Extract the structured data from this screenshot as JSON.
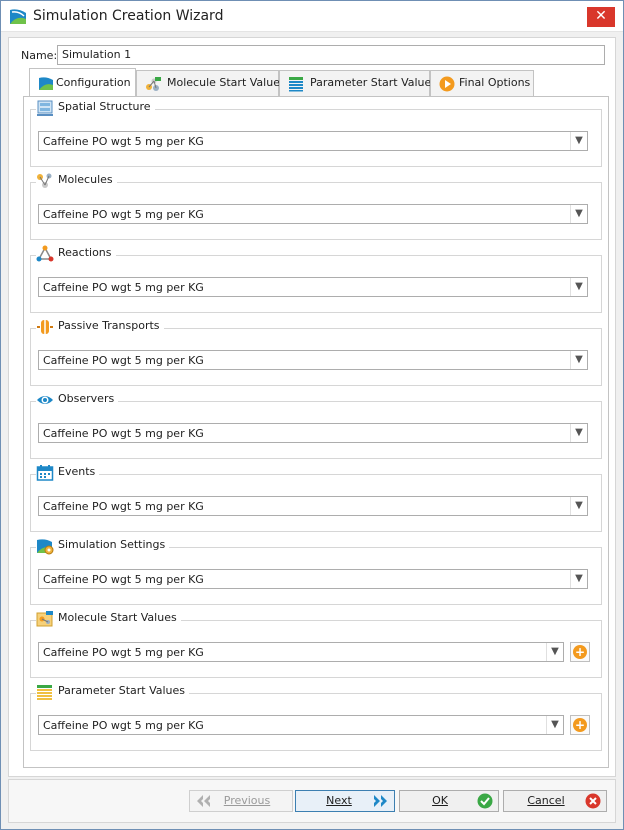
{
  "window": {
    "title": "Simulation Creation Wizard",
    "close_symbol": "✕"
  },
  "name_field": {
    "label": "Name:",
    "value": "Simulation 1"
  },
  "tabs": [
    {
      "label": "Configuration",
      "icon": "configuration-icon",
      "active": true
    },
    {
      "label": "Molecule Start Values",
      "icon": "molecule-start-values-icon",
      "active": false
    },
    {
      "label": "Parameter Start Values",
      "icon": "parameter-start-values-icon",
      "active": false
    },
    {
      "label": "Final Options",
      "icon": "final-options-icon",
      "active": false
    }
  ],
  "groups": [
    {
      "label": "Spatial Structure",
      "icon": "spatial-structure-icon",
      "value": "Caffeine PO wgt 5 mg per KG",
      "has_add": false
    },
    {
      "label": "Molecules",
      "icon": "molecules-icon",
      "value": "Caffeine PO wgt 5 mg per KG",
      "has_add": false
    },
    {
      "label": "Reactions",
      "icon": "reactions-icon",
      "value": "Caffeine PO wgt 5 mg per KG",
      "has_add": false
    },
    {
      "label": "Passive Transports",
      "icon": "passive-transports-icon",
      "value": "Caffeine PO wgt 5 mg per KG",
      "has_add": false
    },
    {
      "label": "Observers",
      "icon": "observers-icon",
      "value": "Caffeine PO wgt 5 mg per KG",
      "has_add": false
    },
    {
      "label": "Events",
      "icon": "events-icon",
      "value": "Caffeine PO wgt 5 mg per KG",
      "has_add": false
    },
    {
      "label": "Simulation Settings",
      "icon": "simulation-settings-icon",
      "value": "Caffeine PO wgt 5 mg per KG",
      "has_add": false
    },
    {
      "label": "Molecule Start Values",
      "icon": "molecule-start-values-icon",
      "value": "Caffeine PO wgt 5 mg per KG",
      "has_add": true
    },
    {
      "label": "Parameter Start Values",
      "icon": "parameter-start-values-icon",
      "value": "Caffeine PO wgt 5 mg per KG",
      "has_add": true
    }
  ],
  "buttons": {
    "previous": {
      "label": "Previous",
      "enabled": false
    },
    "next": {
      "label": "Next",
      "enabled": true
    },
    "ok": {
      "label": "OK",
      "enabled": true
    },
    "cancel": {
      "label": "Cancel",
      "enabled": true
    }
  },
  "colors": {
    "accent_blue": "#1e88c7",
    "add_orange": "#f39a1e",
    "ok_green": "#3aa845",
    "cancel_red": "#d9372b"
  }
}
